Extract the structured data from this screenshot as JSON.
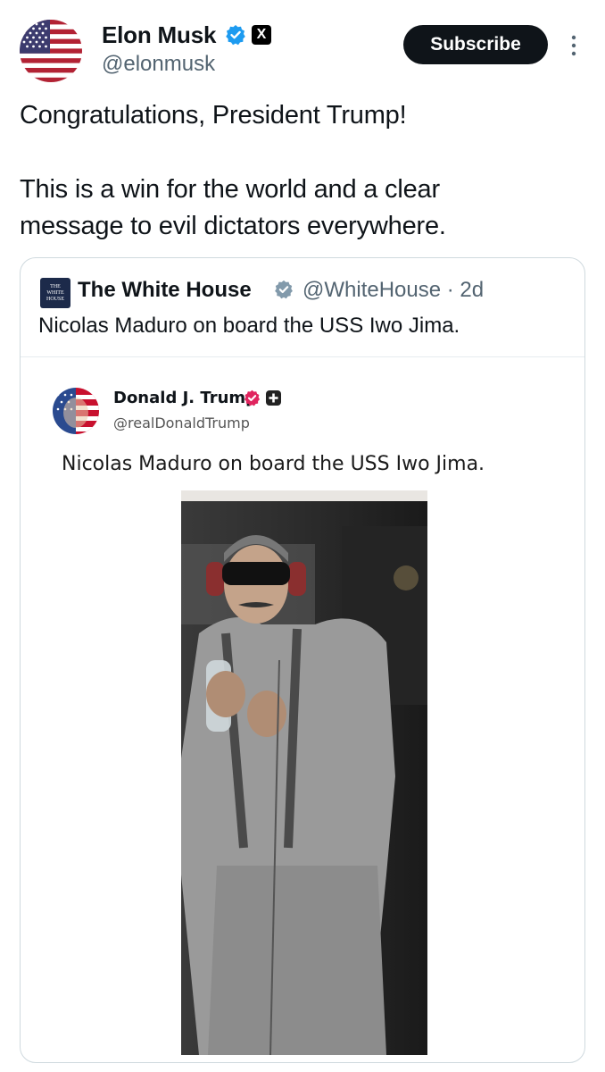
{
  "post": {
    "author_name": "Elon Musk",
    "author_handle": "@elonmusk",
    "subscribe_label": "Subscribe",
    "x_badge": "X",
    "text_lines": [
      "Congratulations, President Trump!",
      "This is a win for the world and a clear",
      "message to evil dictators everywhere."
    ],
    "icons": {
      "avatar": "us-flag-avatar",
      "verified": "verified-badge-icon",
      "more": "more-vertical-icon"
    },
    "colors": {
      "verified_blue": "#1d9bf0",
      "subscribe_bg": "#0f1419",
      "handle_gray": "#536471"
    }
  },
  "quote": {
    "author_name": "The White House",
    "author_handle": "@WhiteHouse",
    "time_ago": "· 2d",
    "text": "Nicolas Maduro on board the USS Iwo Jima.",
    "logo_text": "THE WHITE HOUSE",
    "icons": {
      "verified": "verified-badge-icon",
      "logo": "white-house-logo"
    }
  },
  "embedded": {
    "author_name": "Donald J. Trump",
    "author_handle": "@realDonaldTrump",
    "text": "Nicolas Maduro on board the USS Iwo Jima.",
    "icons": {
      "avatar": "trump-flag-avatar",
      "verified": "truth-verified-badge-icon",
      "plus": "plus-badge-icon",
      "photo": "photo-maduro-blindfolded"
    },
    "colors": {
      "badge_red": "#e0245e"
    }
  }
}
